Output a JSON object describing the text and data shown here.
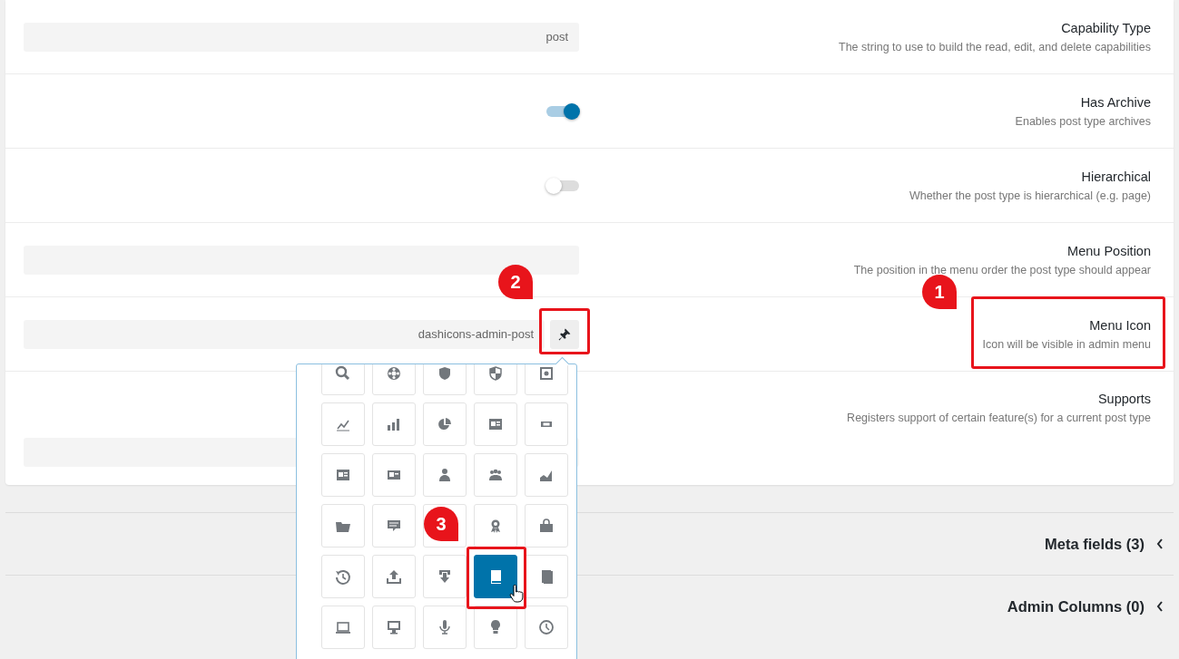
{
  "settings": [
    {
      "kind": "text",
      "title": "Capability Type",
      "description": "The string to use to build the read, edit, and delete capabilities",
      "value": "post"
    },
    {
      "kind": "toggle",
      "title": "Has Archive",
      "description": "Enables post type archives",
      "on": true
    },
    {
      "kind": "toggle",
      "title": "Hierarchical",
      "description": "Whether the post type is hierarchical (e.g. page)",
      "on": false
    },
    {
      "kind": "text",
      "title": "Menu Position",
      "description": "The position in the menu order the post type should appear"
    },
    {
      "kind": "icon",
      "title": "Menu Icon",
      "description": "Icon will be visible in admin menu",
      "value": "dashicons-admin-post"
    },
    {
      "kind": "multi",
      "title": "Supports",
      "description": "Registers support of certain feature(s) for a current post type"
    }
  ],
  "icon_picker": {
    "icons": [
      {
        "kind": "search",
        "selected": false
      },
      {
        "kind": "lifesaver",
        "selected": false
      },
      {
        "kind": "shield",
        "selected": false
      },
      {
        "kind": "shield-half",
        "selected": false
      },
      {
        "kind": "vault",
        "selected": false
      },
      {
        "kind": "chart-line",
        "selected": false
      },
      {
        "kind": "chart-bar",
        "selected": false
      },
      {
        "kind": "chart-pie",
        "selected": false
      },
      {
        "kind": "id-card",
        "selected": false
      },
      {
        "kind": "tickets",
        "selected": false
      },
      {
        "kind": "id-card",
        "selected": false
      },
      {
        "kind": "badge",
        "selected": false
      },
      {
        "kind": "person",
        "selected": false
      },
      {
        "kind": "people",
        "selected": false
      },
      {
        "kind": "chart-area",
        "selected": false
      },
      {
        "kind": "folder",
        "selected": false
      },
      {
        "kind": "comment",
        "selected": false
      },
      {
        "kind": "covered",
        "selected": false
      },
      {
        "kind": "award",
        "selected": false
      },
      {
        "kind": "bag",
        "selected": false
      },
      {
        "kind": "backup",
        "selected": false
      },
      {
        "kind": "upload",
        "selected": false
      },
      {
        "kind": "download",
        "selected": false
      },
      {
        "kind": "book",
        "selected": true
      },
      {
        "kind": "book-alt",
        "selected": false
      },
      {
        "kind": "laptop",
        "selected": false
      },
      {
        "kind": "desktop",
        "selected": false
      },
      {
        "kind": "microphone",
        "selected": false
      },
      {
        "kind": "lightbulb",
        "selected": false
      },
      {
        "kind": "clock",
        "selected": false
      }
    ]
  },
  "sections": [
    {
      "title": "Meta fields (3)",
      "expanded": false
    },
    {
      "title": "Admin Columns (0)",
      "expanded": false
    }
  ],
  "annotations": [
    {
      "number": "1"
    },
    {
      "number": "2"
    },
    {
      "number": "3"
    }
  ]
}
